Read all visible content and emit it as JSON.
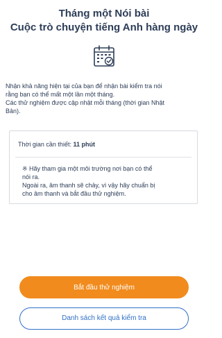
{
  "header": {
    "title_line1": "Tháng một Nói bài",
    "title_line2": "Cuộc trò chuyện tiếng Anh hàng ngày",
    "icon": "calendar-icon"
  },
  "description": {
    "line1": "Nhận khả năng hiện tại của bạn để nhận bài kiểm tra nói",
    "line2": "rằng bạn có thể mất một lần một tháng.",
    "line3": "Các thử nghiệm được cập nhật mỗi tháng (thời gian Nhật",
    "line4": "Bản)."
  },
  "info_card": {
    "time_label": "Thời gian cần thiết:",
    "time_value": "11 phút",
    "note_line1": "※ Hãy tham gia một môi trường nơi bạn có thể",
    "note_line2": "nói ra.",
    "note_line3": "Ngoài ra, âm thanh sẽ chảy, vì vậy hãy chuẩn bị",
    "note_line4": "cho âm thanh và bắt đầu thử nghiệm."
  },
  "buttons": {
    "start_label": "Bắt đầu thử nghiệm",
    "results_label": "Danh sách kết quả kiểm tra"
  },
  "colors": {
    "primary_orange": "#f18b1d",
    "link_blue": "#2f6fc7",
    "text_dark": "#2d3d57"
  }
}
